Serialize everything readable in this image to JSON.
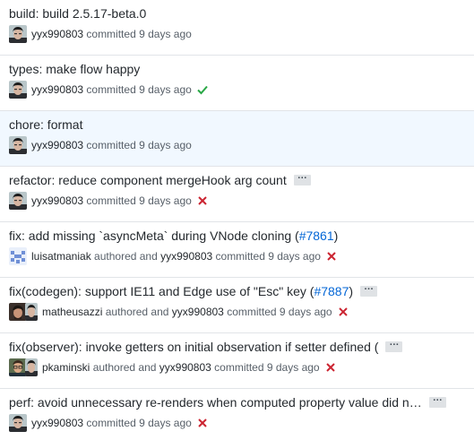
{
  "commits": [
    {
      "title": "build: build 2.5.17-beta.0",
      "committer": "yyx990803",
      "verb": "committed",
      "time": "9 days ago"
    },
    {
      "title": "types: make flow happy",
      "committer": "yyx990803",
      "verb": "committed",
      "time": "9 days ago",
      "status": "success"
    },
    {
      "title": "chore: format",
      "committer": "yyx990803",
      "verb": "committed",
      "time": "9 days ago"
    },
    {
      "title": "refactor: reduce component mergeHook arg count",
      "expander": "…",
      "committer": "yyx990803",
      "verb": "committed",
      "time": "9 days ago",
      "status": "failure"
    },
    {
      "title": "fix: add missing `asyncMeta` during VNode cloning (",
      "pr": "#7861",
      "title_close": ")",
      "author": "luisatmaniak",
      "authored": "authored and",
      "committer": "yyx990803",
      "verb": "committed",
      "time": "9 days ago",
      "status": "failure"
    },
    {
      "title": "fix(codegen): support IE11 and Edge use of \"Esc\" key (",
      "pr": "#7887",
      "title_close": ")",
      "expander": "…",
      "author": "matheusazzi",
      "authored": "authored and",
      "committer": "yyx990803",
      "verb": "committed",
      "time": "9 days ago",
      "status": "failure"
    },
    {
      "title": "fix(observer): invoke getters on initial observation if setter defined (",
      "expander": "…",
      "author": "pkaminski",
      "authored": "authored and",
      "committer": "yyx990803",
      "verb": "committed",
      "time": "9 days ago",
      "status": "failure"
    },
    {
      "title": "perf: avoid unnecessary re-renders when computed property value did n…",
      "expander": "…",
      "committer": "yyx990803",
      "verb": "committed",
      "time": "9 days ago",
      "status": "failure"
    }
  ],
  "colors": {
    "link": "#0366d6",
    "success": "#28a745",
    "failure": "#cb2431",
    "highlight_row": "#f1f8ff",
    "border": "#e1e4e8",
    "meta_text": "#586069"
  },
  "icons": {
    "success": "check-icon",
    "failure": "x-icon",
    "avatar": "user-avatar"
  }
}
